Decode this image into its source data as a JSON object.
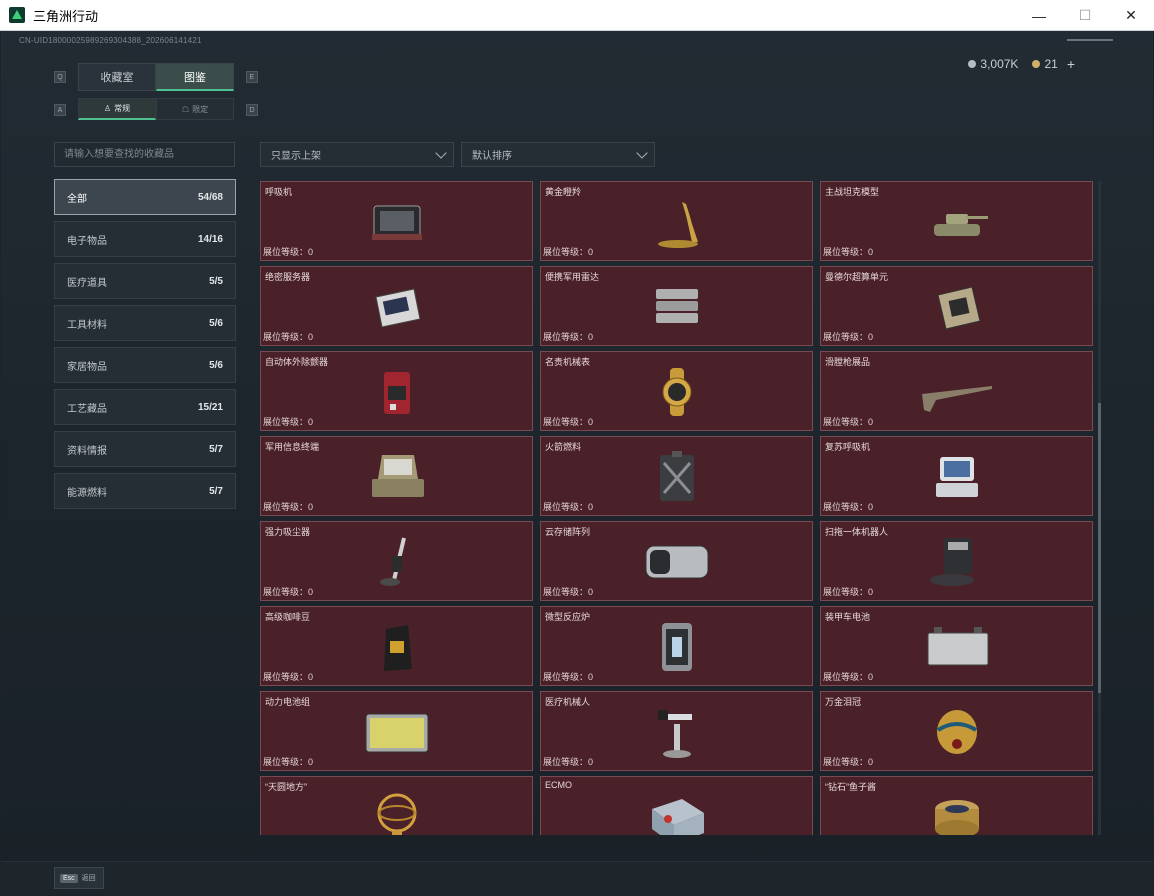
{
  "window": {
    "title": "三角洲行动",
    "minimize": "—",
    "maximize": "☐",
    "close": "✕"
  },
  "uid": "CN-UID18000025989269304388_202606141421",
  "currency": {
    "silver": "3,007K",
    "gold": "21",
    "add": "+"
  },
  "key_hints": {
    "q": "Q",
    "e": "E",
    "a": "A",
    "d": "D"
  },
  "tabs": {
    "collection": "收藏室",
    "codex": "图鉴",
    "normal": "常规",
    "limited": "限定"
  },
  "search": {
    "placeholder": "请输入想要查找的收藏品"
  },
  "categories": [
    {
      "label": "全部",
      "count": "54/68",
      "active": true
    },
    {
      "label": "电子物品",
      "count": "14/16"
    },
    {
      "label": "医疗道具",
      "count": "5/5"
    },
    {
      "label": "工具材料",
      "count": "5/6"
    },
    {
      "label": "家居物品",
      "count": "5/6"
    },
    {
      "label": "工艺藏品",
      "count": "15/21"
    },
    {
      "label": "资料情报",
      "count": "5/7"
    },
    {
      "label": "能源燃料",
      "count": "5/7"
    }
  ],
  "filters": {
    "shelf": "只显示上架",
    "sort": "默认排序"
  },
  "level_label": "展位等级：0",
  "items": [
    {
      "name": "呼吸机",
      "icon": "ventilator-icon"
    },
    {
      "name": "黄金瞪羚",
      "icon": "golden-gazelle-icon"
    },
    {
      "name": "主战坦克模型",
      "icon": "tank-model-icon"
    },
    {
      "name": "绝密服务器",
      "icon": "server-icon"
    },
    {
      "name": "便携军用雷达",
      "icon": "radar-icon"
    },
    {
      "name": "曼德尔超算单元",
      "icon": "supercomputer-icon"
    },
    {
      "name": "自动体外除颤器",
      "icon": "defibrillator-icon"
    },
    {
      "name": "名贵机械表",
      "icon": "watch-icon"
    },
    {
      "name": "滑膛枪展品",
      "icon": "musket-icon"
    },
    {
      "name": "军用信息终端",
      "icon": "terminal-icon"
    },
    {
      "name": "火箭燃料",
      "icon": "fuel-can-icon"
    },
    {
      "name": "复苏呼吸机",
      "icon": "resuscitator-icon"
    },
    {
      "name": "强力吸尘器",
      "icon": "vacuum-icon"
    },
    {
      "name": "云存储阵列",
      "icon": "storage-array-icon"
    },
    {
      "name": "扫拖一体机器人",
      "icon": "robot-vacuum-icon"
    },
    {
      "name": "高级咖啡豆",
      "icon": "coffee-bag-icon"
    },
    {
      "name": "微型反应炉",
      "icon": "reactor-icon"
    },
    {
      "name": "装甲车电池",
      "icon": "battery-icon"
    },
    {
      "name": "动力电池组",
      "icon": "battery-pack-icon"
    },
    {
      "name": "医疗机械人",
      "icon": "medical-robot-icon"
    },
    {
      "name": "万金泪冠",
      "icon": "egg-crown-icon"
    },
    {
      "name": "“天圆地方”",
      "icon": "armillary-icon"
    },
    {
      "name": "ECMO",
      "icon": "ecmo-icon"
    },
    {
      "name": "“钻石”鱼子酱",
      "icon": "caviar-icon"
    }
  ],
  "bottom": {
    "esc_key": "Esc",
    "back": "返回"
  },
  "colors": {
    "card_bg": "#4a2128",
    "accent": "#4fc08f"
  }
}
